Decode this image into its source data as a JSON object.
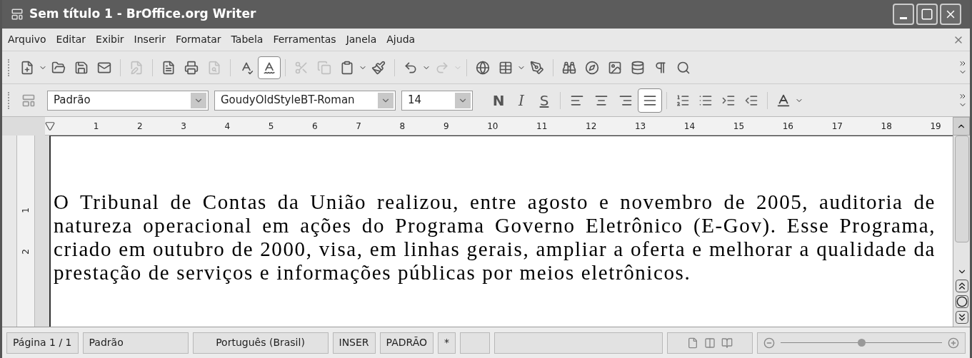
{
  "window": {
    "title": "Sem título 1 - BrOffice.org Writer"
  },
  "menu": [
    {
      "label": "Arquivo"
    },
    {
      "label": "Editar"
    },
    {
      "label": "Exibir"
    },
    {
      "label": "Inserir"
    },
    {
      "label": "Formatar"
    },
    {
      "label": "Tabela"
    },
    {
      "label": "Ferramentas"
    },
    {
      "label": "Janela"
    },
    {
      "label": "Ajuda"
    }
  ],
  "standard_toolbar": {
    "items": [
      {
        "kind": "button",
        "disabled": false,
        "selected": false,
        "dropdown": true
      },
      {
        "kind": "button",
        "disabled": false,
        "selected": false,
        "dropdown": false
      },
      {
        "kind": "button",
        "disabled": false,
        "selected": false,
        "dropdown": false
      },
      {
        "kind": "button",
        "disabled": false,
        "selected": false,
        "dropdown": false
      },
      {
        "kind": "separator"
      },
      {
        "kind": "button",
        "disabled": true,
        "selected": false,
        "dropdown": false
      },
      {
        "kind": "separator"
      },
      {
        "kind": "button",
        "disabled": false,
        "selected": false,
        "dropdown": false
      },
      {
        "kind": "button",
        "disabled": false,
        "selected": false,
        "dropdown": false
      },
      {
        "kind": "button",
        "disabled": true,
        "selected": false,
        "dropdown": false
      },
      {
        "kind": "separator"
      },
      {
        "kind": "button",
        "disabled": false,
        "selected": false,
        "dropdown": false
      },
      {
        "kind": "button",
        "disabled": false,
        "selected": true,
        "dropdown": false
      },
      {
        "kind": "separator"
      },
      {
        "kind": "button",
        "disabled": true,
        "selected": false,
        "dropdown": false
      },
      {
        "kind": "button",
        "disabled": true,
        "selected": false,
        "dropdown": false
      },
      {
        "kind": "button",
        "disabled": false,
        "selected": false,
        "dropdown": true
      },
      {
        "kind": "button",
        "disabled": false,
        "selected": false,
        "dropdown": false
      },
      {
        "kind": "separator"
      },
      {
        "kind": "button",
        "disabled": false,
        "selected": false,
        "dropdown": true
      },
      {
        "kind": "button",
        "disabled": true,
        "selected": false,
        "dropdown": true
      },
      {
        "kind": "separator"
      },
      {
        "kind": "button",
        "disabled": false,
        "selected": false,
        "dropdown": false
      },
      {
        "kind": "button",
        "disabled": false,
        "selected": false,
        "dropdown": true
      },
      {
        "kind": "button",
        "disabled": false,
        "selected": false,
        "dropdown": false
      },
      {
        "kind": "separator"
      },
      {
        "kind": "button",
        "disabled": false,
        "selected": false,
        "dropdown": false
      },
      {
        "kind": "button",
        "disabled": false,
        "selected": false,
        "dropdown": false
      },
      {
        "kind": "button",
        "disabled": false,
        "selected": false,
        "dropdown": false
      },
      {
        "kind": "button",
        "disabled": false,
        "selected": false,
        "dropdown": false
      },
      {
        "kind": "button",
        "disabled": false,
        "selected": false,
        "dropdown": false
      },
      {
        "kind": "button",
        "disabled": false,
        "selected": false,
        "dropdown": false
      }
    ]
  },
  "formatting_toolbar": {
    "paragraph_style": "Padrão",
    "font_name": "GoudyOldStyleBT-Roman",
    "font_size": "14",
    "text_buttons": [
      {
        "label": "N",
        "selected": false
      },
      {
        "label": "I",
        "selected": false
      },
      {
        "label": "S",
        "selected": false
      }
    ],
    "align_buttons": [
      {
        "selected": false
      },
      {
        "selected": false
      },
      {
        "selected": false
      },
      {
        "selected": true
      }
    ]
  },
  "ruler": {
    "marks": [
      "1",
      "2",
      "3",
      "4",
      "5",
      "6",
      "7",
      "8",
      "9",
      "10",
      "11",
      "12",
      "13",
      "14",
      "15",
      "16",
      "17",
      "18",
      "19"
    ]
  },
  "vertical_ruler": {
    "marks": [
      "1",
      "2"
    ]
  },
  "document": {
    "text": "O Tribunal de Contas da União realizou, entre agosto e novembro de 2005, auditoria de natureza operacional em ações do Programa Governo Eletrônico (E-Gov). Esse Programa, criado em outubro de 2000, visa, em linhas gerais, ampliar a oferta e melhorar a qualidade da prestação de serviços e informações públicas por meios eletrônicos."
  },
  "status_bar": {
    "page": "Página 1 / 1",
    "page_style": "Padrão",
    "language": "Português (Brasil)",
    "insert_mode": "INSER",
    "selection_mode": "PADRÃO",
    "modified": "*",
    "zoom": {
      "level": 0.5
    }
  }
}
